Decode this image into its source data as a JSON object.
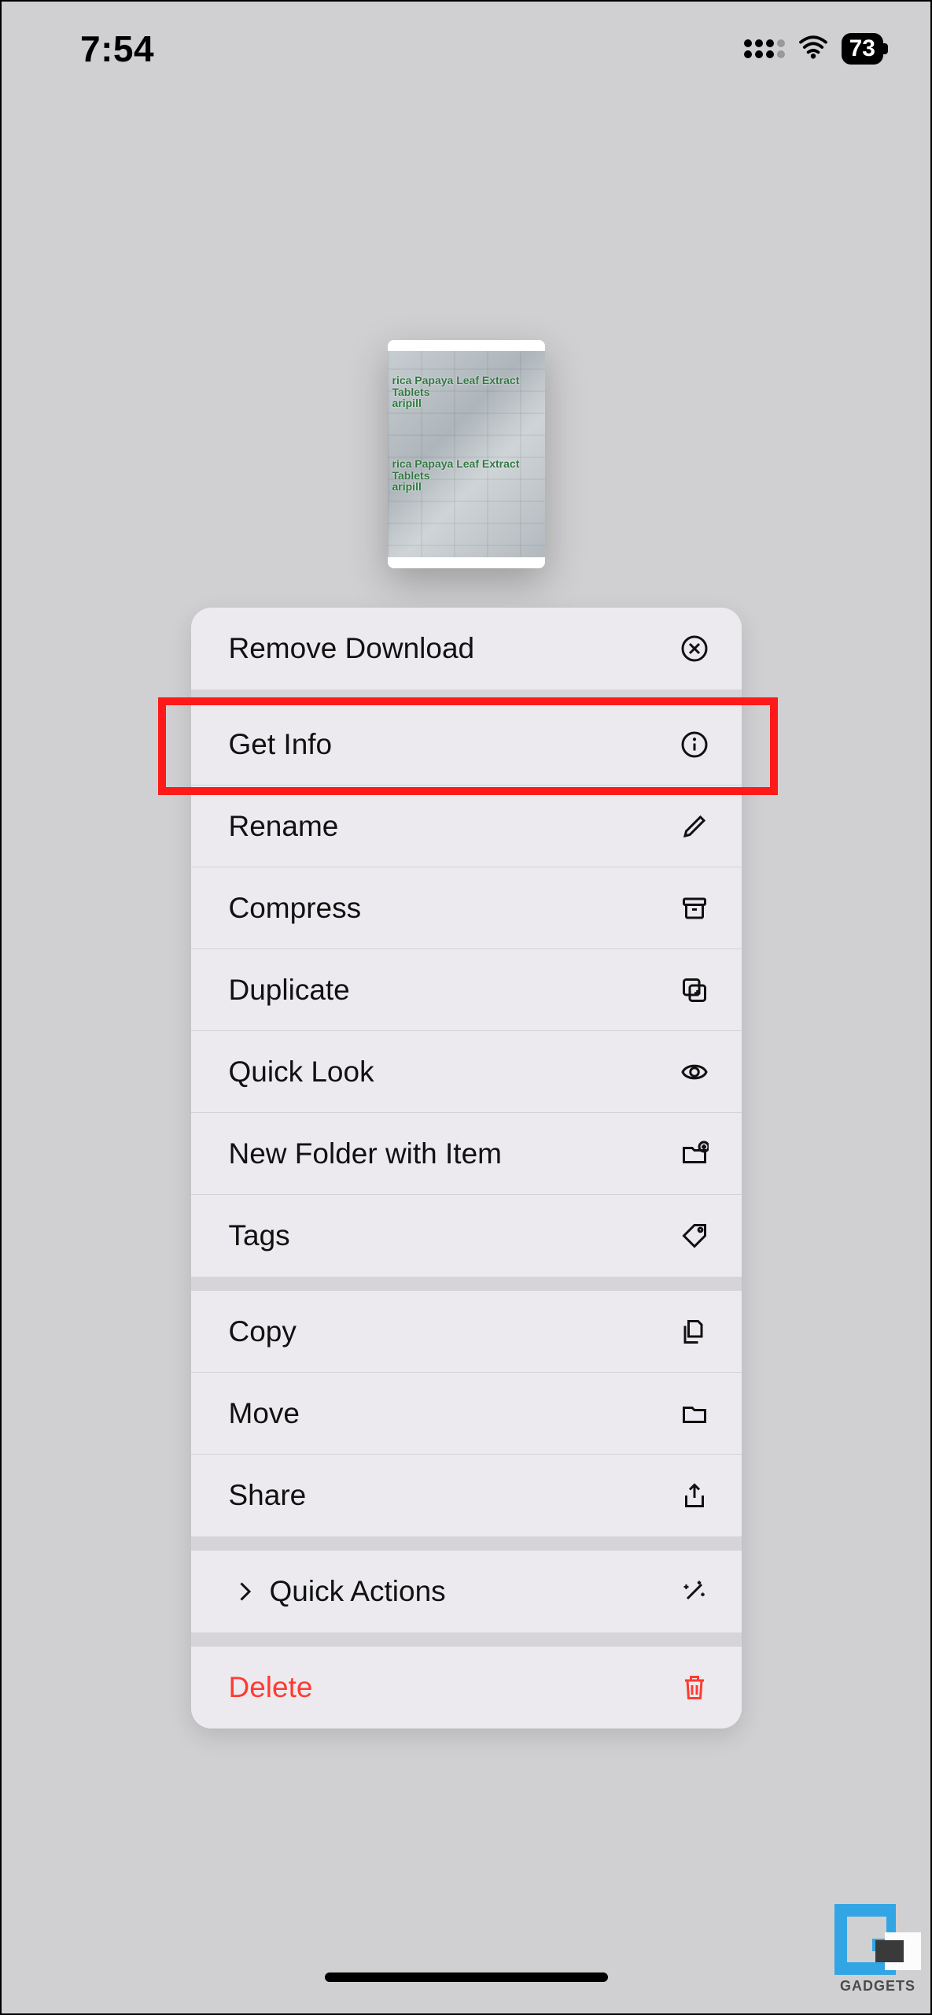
{
  "status": {
    "time": "7:54",
    "battery": "73"
  },
  "thumbnail": {
    "line1": "rica Papaya Leaf Extract Tablets",
    "brand": "aripill"
  },
  "menu": {
    "remove_download": "Remove Download",
    "get_info": "Get Info",
    "rename": "Rename",
    "compress": "Compress",
    "duplicate": "Duplicate",
    "quick_look": "Quick Look",
    "new_folder": "New Folder with Item",
    "tags": "Tags",
    "copy": "Copy",
    "move": "Move",
    "share": "Share",
    "quick_actions": "Quick Actions",
    "delete": "Delete"
  },
  "highlight": {
    "target": "get_info"
  },
  "watermark": {
    "text": "GADGETS"
  }
}
